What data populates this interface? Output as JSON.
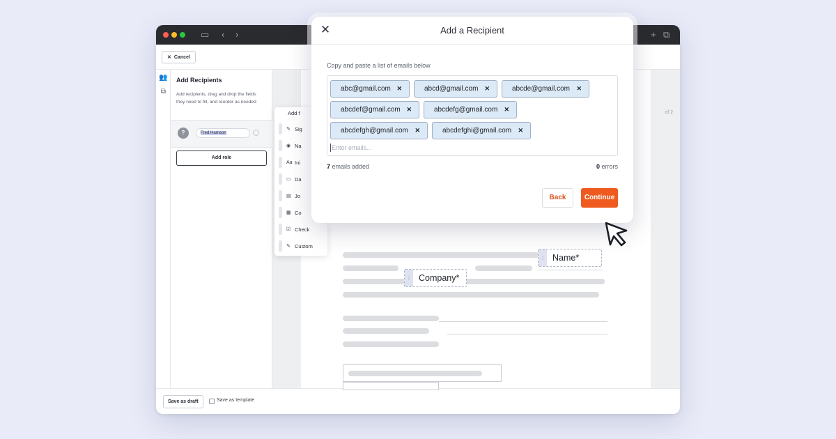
{
  "browser": {
    "toolbar": {
      "cancel_label": "Cancel"
    },
    "sidebar": {
      "title": "Add Recipients",
      "description": "Add recipients, drag and drop the fields they need to fill, and reorder as needed",
      "role": {
        "avatar": "?",
        "name": "Fred Harrison"
      },
      "add_role_label": "Add role"
    },
    "fields_menu": {
      "header": "Add f",
      "items": [
        {
          "icon": "signature-icon",
          "glyph": "✎",
          "label": "Sig"
        },
        {
          "icon": "person-icon",
          "glyph": "◉",
          "label": "Na"
        },
        {
          "icon": "text-icon",
          "glyph": "Aa",
          "label": "Ini"
        },
        {
          "icon": "calendar-icon",
          "glyph": "▭",
          "label": "Da"
        },
        {
          "icon": "briefcase-icon",
          "glyph": "▤",
          "label": "Jo"
        },
        {
          "icon": "building-icon",
          "glyph": "▦",
          "label": "Co"
        },
        {
          "icon": "checkbox-icon",
          "glyph": "☑",
          "label": "Check"
        },
        {
          "icon": "pencil-icon",
          "glyph": "✎",
          "label": "Custom"
        }
      ]
    },
    "page_indicator": "of 2",
    "footer": {
      "save_draft_label": "Save as draft",
      "save_template_label": "Save as template"
    },
    "document_fields": {
      "name_field": "Name*",
      "company_field": "Company*"
    }
  },
  "modal": {
    "title": "Add a Recipient",
    "instructions": "Copy and paste a list of emails below",
    "emails": [
      "abc@gmail.com",
      "abcd@gmail.com",
      "abcde@gmail.com",
      "abcdef@gmail.com",
      "abcdefg@gmail.com",
      "abcdefgh@gmail.com",
      "abcdefghi@gmail.com"
    ],
    "input_placeholder": "Enter emails...",
    "added_count": "7",
    "added_suffix": " emails added",
    "error_count": "0",
    "error_suffix": " errors",
    "back_label": "Back",
    "continue_label": "Continue"
  },
  "colors": {
    "accent": "#ef5a1f",
    "chip_bg": "#dce9f6",
    "backdrop": "#e9ebf8"
  }
}
